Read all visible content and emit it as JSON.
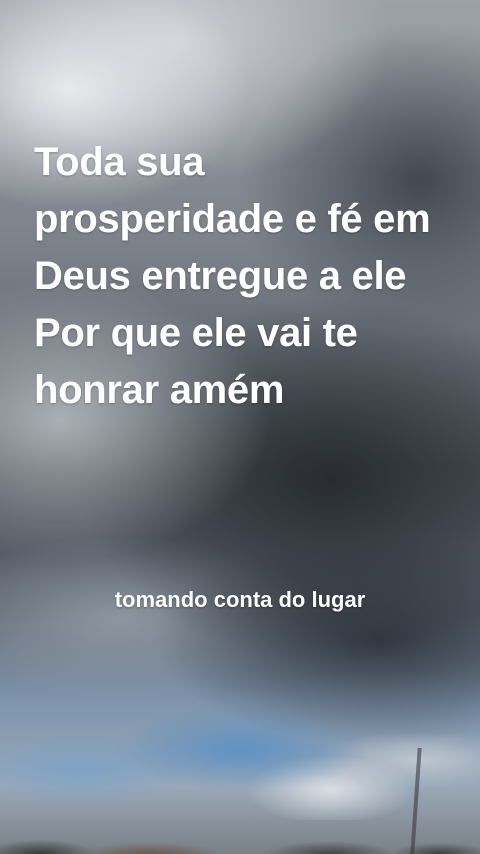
{
  "overlay": {
    "main_text": "Toda sua prosperidade e fé em Deus entregue a ele Por que ele vai te honrar amém",
    "caption": "tomando conta do lugar"
  },
  "colors": {
    "text": "#ffffff"
  }
}
